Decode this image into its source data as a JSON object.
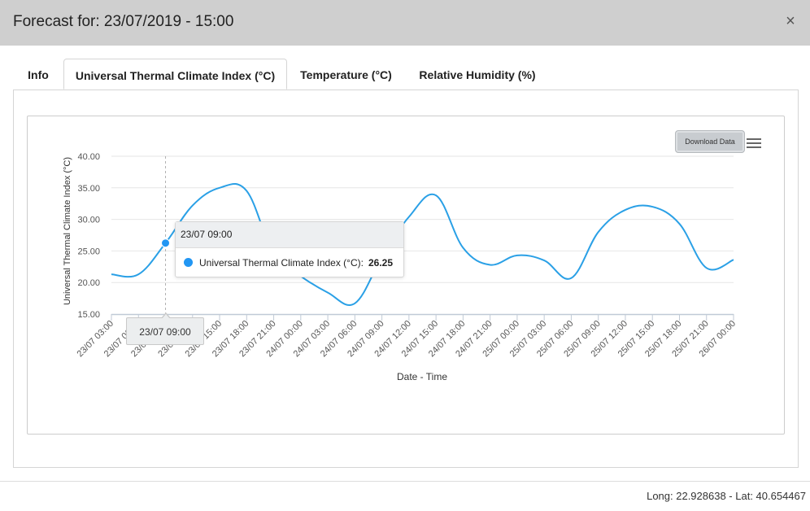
{
  "modal": {
    "title": "Forecast for: 23/07/2019 - 15:00",
    "close_icon": "close-icon",
    "close_glyph": "×"
  },
  "tabs": [
    {
      "label": "Info",
      "active": false
    },
    {
      "label": "Universal Thermal Climate Index (°C)",
      "active": true
    },
    {
      "label": "Temperature (°C)",
      "active": false
    },
    {
      "label": "Relative Humidity (%)",
      "active": false
    }
  ],
  "toolbar": {
    "download_label": "Download Data",
    "menu_icon": "hamburger-menu-icon"
  },
  "tooltip": {
    "header": "23/07 09:00",
    "series_label": "Universal Thermal Climate Index (°C):",
    "value": "26.25"
  },
  "crosshair_label": "23/07 09:00",
  "footer": {
    "coords": "Long: 22.928638 - Lat: 40.654467"
  },
  "chart_data": {
    "type": "line",
    "title": "",
    "xlabel": "Date - Time",
    "ylabel": "Universal Thermal Climate Index (°C)",
    "ylim": [
      15,
      40
    ],
    "yticks": [
      "15.00",
      "20.00",
      "25.00",
      "30.00",
      "35.00",
      "40.00"
    ],
    "grid": true,
    "line_color": "#2aa0e6",
    "highlight_index": 2,
    "categories": [
      "23/07 03:00",
      "23/07 06:00",
      "23/07 09:00",
      "23/07 12:00",
      "23/07 15:00",
      "23/07 18:00",
      "23/07 21:00",
      "24/07 00:00",
      "24/07 03:00",
      "24/07 06:00",
      "24/07 09:00",
      "24/07 12:00",
      "24/07 15:00",
      "24/07 18:00",
      "24/07 21:00",
      "25/07 00:00",
      "25/07 03:00",
      "25/07 06:00",
      "25/07 09:00",
      "25/07 12:00",
      "25/07 15:00",
      "25/07 18:00",
      "25/07 21:00",
      "26/07 00:00"
    ],
    "series": [
      {
        "values": [
          21.3,
          21.3,
          26.25,
          32.2,
          35.0,
          34.5,
          24.5,
          21.0,
          18.4,
          16.7,
          24.0,
          30.4,
          33.8,
          25.5,
          22.8,
          24.3,
          23.5,
          20.7,
          28.0,
          31.5,
          32.0,
          29.3,
          22.3,
          23.6
        ]
      }
    ]
  }
}
